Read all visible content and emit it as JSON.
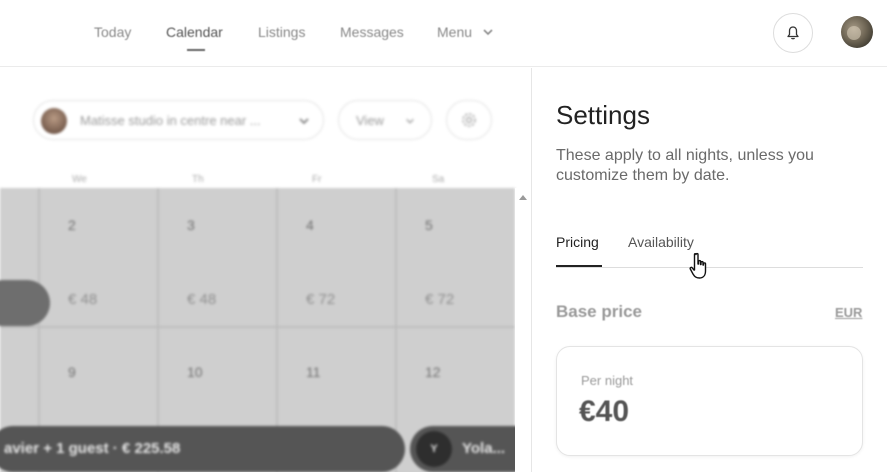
{
  "nav": {
    "items": [
      {
        "label": "Today"
      },
      {
        "label": "Calendar"
      },
      {
        "label": "Listings"
      },
      {
        "label": "Messages"
      },
      {
        "label": "Menu"
      }
    ],
    "active": "Calendar"
  },
  "calendar": {
    "listing_selector": "Matisse studio in centre near ...",
    "view_label": "View",
    "day_headers": [
      "We",
      "Th",
      "Fr",
      "Sa"
    ],
    "weeks": [
      {
        "dates": [
          "2",
          "3",
          "4",
          "5"
        ],
        "prices": [
          "€ 48",
          "€ 48",
          "€ 72",
          "€ 72"
        ]
      },
      {
        "dates": [
          "9",
          "10",
          "11",
          "12"
        ]
      }
    ],
    "booking_text": "avier + 1 guest · € 225.58",
    "booking_right_initial": "Y",
    "booking_right_text": "Yola..."
  },
  "settings": {
    "title": "Settings",
    "subtitle": "These apply to all nights, unless you customize them by date.",
    "tabs": [
      {
        "label": "Pricing",
        "active": true
      },
      {
        "label": "Availability",
        "active": false
      }
    ],
    "base_price_label": "Base price",
    "currency": "EUR",
    "per_night_label": "Per night",
    "price": "€40"
  },
  "colors": {
    "text_primary": "#222222",
    "text_muted": "#6a6a6a",
    "calendar_grid": "#cfcfcf",
    "booking_bar": "#555555"
  }
}
